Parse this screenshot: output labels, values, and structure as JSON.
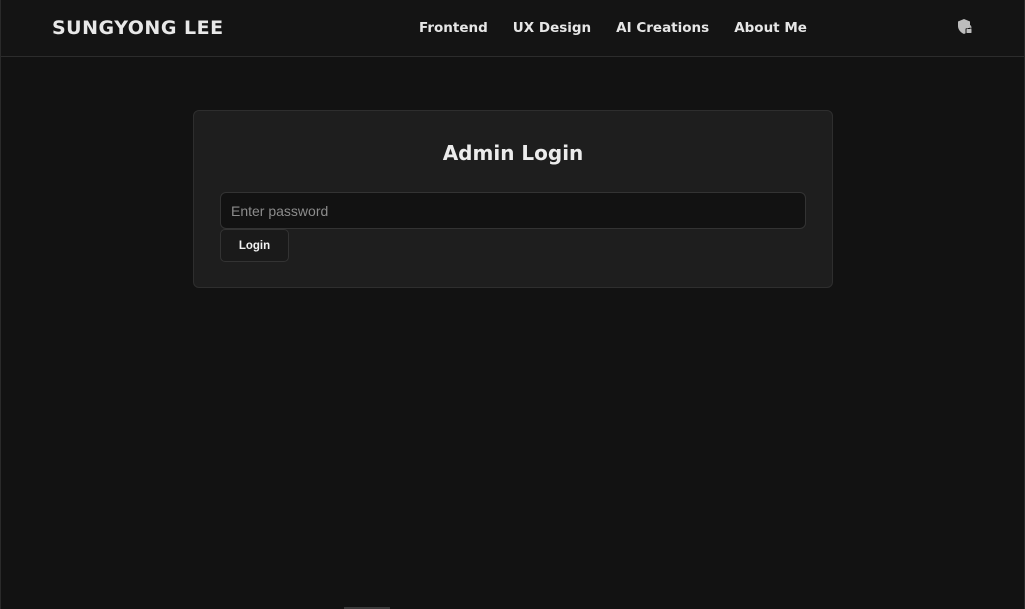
{
  "header": {
    "brand": "SUNGYONG LEE",
    "nav": [
      {
        "label": "Frontend"
      },
      {
        "label": "UX Design"
      },
      {
        "label": "AI Creations"
      },
      {
        "label": "About Me"
      }
    ],
    "admin_icon": "shield-lock-icon"
  },
  "login": {
    "title": "Admin Login",
    "password_placeholder": "Enter password",
    "password_value": "",
    "button_label": "Login"
  },
  "colors": {
    "background": "#121212",
    "card": "#1e1e1e",
    "text": "#e6e6e6",
    "placeholder": "#8c8c8c"
  }
}
